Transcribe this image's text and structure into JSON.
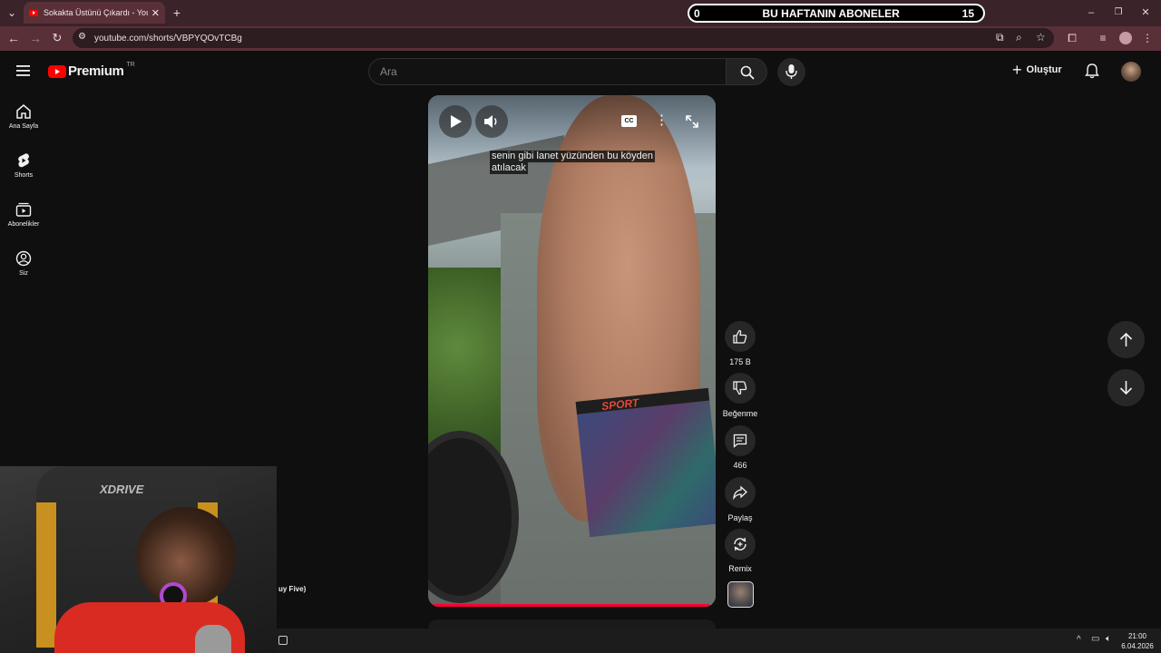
{
  "browser": {
    "tab_title": "Sokakta Üstünü Çıkardı - YouTu",
    "url": "youtube.com/shorts/VBPYQOvTCBg"
  },
  "subscriber_banner": {
    "left_count": "0",
    "title": "BU HAFTANIN ABONELER",
    "right_count": "15"
  },
  "header": {
    "logo_text": "Premium",
    "country_code": "TR",
    "search_placeholder": "Ara",
    "create_label": "Oluştur"
  },
  "sidebar": {
    "items": [
      {
        "label": "Ana Sayfa",
        "icon": "home-icon"
      },
      {
        "label": "Shorts",
        "icon": "shorts-icon"
      },
      {
        "label": "Abonelikler",
        "icon": "subscriptions-icon"
      },
      {
        "label": "Siz",
        "icon": "you-icon"
      }
    ]
  },
  "video": {
    "caption_line1": "senin gibi lanet yüzünden bu köyden",
    "caption_line2": "atılacak",
    "cc_label": "CC",
    "shorts_text_sport": "SPORT",
    "progress": 0.98
  },
  "actions": {
    "like_count": "175 B",
    "dislike_label": "Beğenme",
    "comment_count": "466",
    "share_label": "Paylaş",
    "remix_label": "Remix"
  },
  "webcam": {
    "chair_brand": "XDRIVE",
    "overlay_text": "uy Five)"
  },
  "taskbar": {
    "time": "21:00",
    "date": "6.04.2026"
  },
  "colors": {
    "tab_bar": "#3a2329",
    "address_bar": "#5a3038",
    "youtube_red": "#ff0000",
    "progress_red": "#ff0033",
    "background": "#0f0f0f"
  }
}
